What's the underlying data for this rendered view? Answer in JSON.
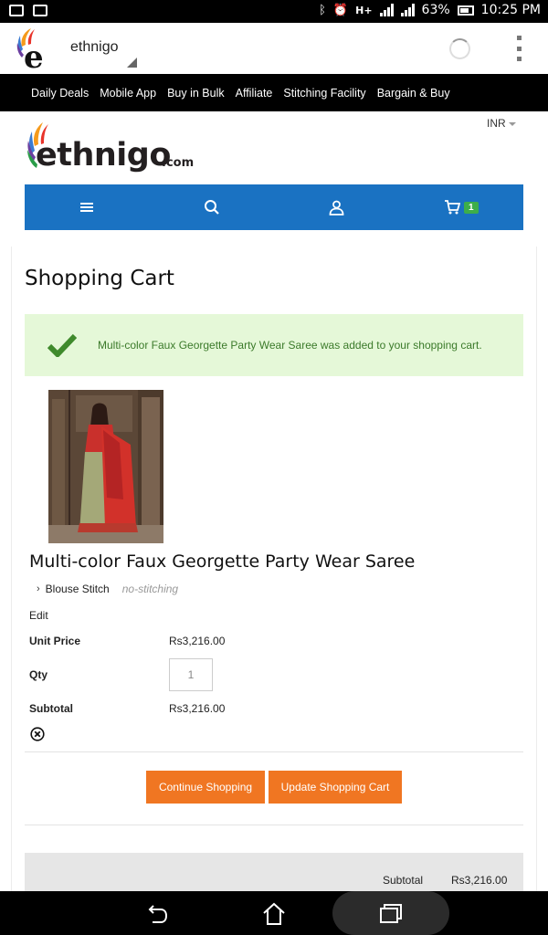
{
  "status_bar": {
    "battery": "63%",
    "time": "10:25 PM",
    "icons": [
      "gallery-icon",
      "gmail-icon",
      "bluetooth-icon",
      "alarm-icon",
      "hplus-icon",
      "signal-icon-1",
      "signal-icon-2",
      "battery-icon"
    ]
  },
  "browser": {
    "tab_title": "ethnigo"
  },
  "top_nav": {
    "items": [
      "Daily Deals",
      "Mobile App",
      "Buy in Bulk",
      "Affiliate",
      "Stitching Facility",
      "Bargain & Buy"
    ]
  },
  "currency": "INR",
  "logo": {
    "word": "ethnigo",
    "suffix": ".com"
  },
  "toolbar": {
    "icons": [
      "menu-icon",
      "search-icon",
      "account-icon",
      "cart-icon"
    ],
    "cart_count": "1",
    "color": "#1a72c2"
  },
  "page": {
    "title": "Shopping Cart",
    "success_message": "Multi-color Faux Georgette Party Wear Saree was added to your shopping cart."
  },
  "product": {
    "name": "Multi-color Faux Georgette Party Wear Saree",
    "option_label": "Blouse Stitch",
    "option_value": "no-stitching",
    "edit_label": "Edit",
    "unit_price_label": "Unit Price",
    "unit_price": "Rs3,216.00",
    "qty_label": "Qty",
    "qty": "1",
    "subtotal_label": "Subtotal",
    "subtotal": "Rs3,216.00"
  },
  "buttons": {
    "continue": "Continue Shopping",
    "update": "Update Shopping Cart",
    "color": "#f07622"
  },
  "totals": {
    "subtotal_label": "Subtotal",
    "subtotal_value": "Rs3,216.00"
  }
}
